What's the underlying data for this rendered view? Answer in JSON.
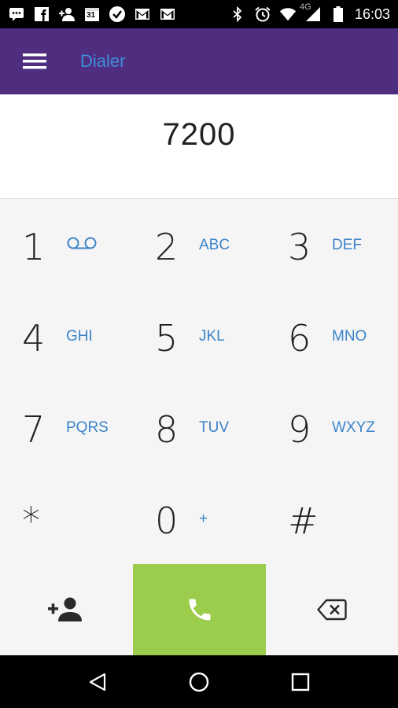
{
  "status_bar": {
    "time": "16:03",
    "network_label": "4G",
    "icons": [
      "message-icon",
      "facebook-icon",
      "add-user-icon",
      "calendar-icon",
      "check-icon",
      "gmail-icon",
      "gmail-icon",
      "bluetooth-icon",
      "alarm-icon",
      "wifi-icon",
      "signal-icon",
      "battery-icon"
    ],
    "calendar_day": "31"
  },
  "app_bar": {
    "title": "Dialer",
    "bg_color": "#4f2d7f",
    "title_color": "#3d8fdc"
  },
  "dialer": {
    "number": "7200"
  },
  "keypad": [
    {
      "digit": "1",
      "letters": "",
      "icon": "voicemail-icon"
    },
    {
      "digit": "2",
      "letters": "ABC"
    },
    {
      "digit": "3",
      "letters": "DEF"
    },
    {
      "digit": "4",
      "letters": "GHI"
    },
    {
      "digit": "5",
      "letters": "JKL"
    },
    {
      "digit": "6",
      "letters": "MNO"
    },
    {
      "digit": "7",
      "letters": "PQRS"
    },
    {
      "digit": "8",
      "letters": "TUV"
    },
    {
      "digit": "9",
      "letters": "WXYZ"
    },
    {
      "digit": "*",
      "letters": ""
    },
    {
      "digit": "0",
      "letters": "+"
    },
    {
      "digit": "#",
      "letters": ""
    }
  ],
  "actions": {
    "add_contact_icon": "add-contact-icon",
    "call_icon": "phone-icon",
    "call_color": "#9ccc4b",
    "backspace_icon": "backspace-icon"
  },
  "nav_bar": {
    "icons": [
      "back-icon",
      "home-icon",
      "recents-icon"
    ]
  }
}
